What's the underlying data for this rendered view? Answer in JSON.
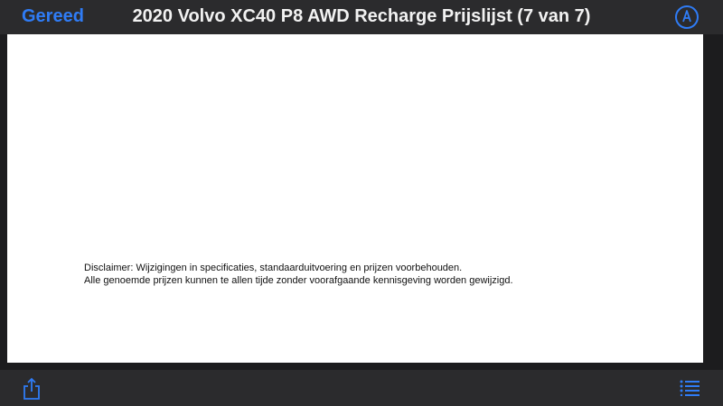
{
  "toolbar": {
    "done_label": "Gereed",
    "title": "2020 Volvo XC40 P8 AWD Recharge Prijslijst (7 van 7)",
    "markup_icon": "markup-pen-icon",
    "share_icon": "share-icon",
    "outline_icon": "list-outline-icon"
  },
  "document": {
    "disclaimer_line1": "Disclaimer: Wijzigingen in specificaties, standaarduitvoering en prijzen voorbehouden.",
    "disclaimer_line2": "Alle genoemde prijzen kunnen te allen tijde zonder voorafgaande kennisgeving worden gewijzigd."
  },
  "colors": {
    "accent": "#2f7cf6",
    "bar_background": "#2b2b2d",
    "page_background": "#ffffff"
  }
}
